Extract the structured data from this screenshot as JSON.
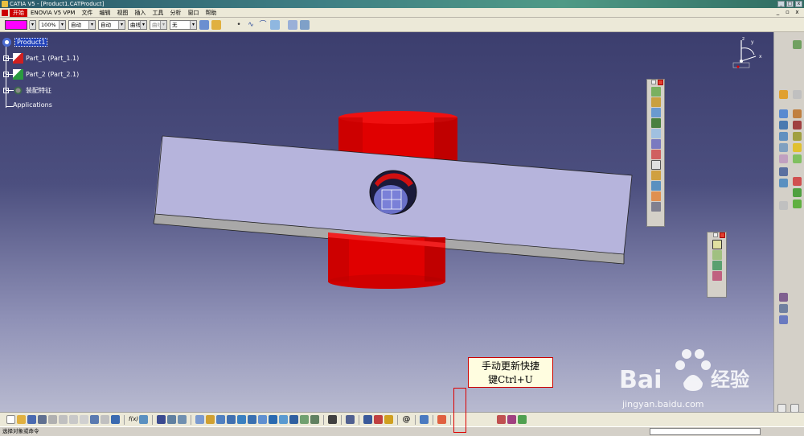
{
  "window": {
    "title": "CATIA V5 - [Product1.CATProduct]"
  },
  "menubar": {
    "items": [
      {
        "label": "开始",
        "active": true
      },
      {
        "label": "ENOVIA V5 VPM"
      },
      {
        "label": "文件"
      },
      {
        "label": "编辑"
      },
      {
        "label": "视图"
      },
      {
        "label": "插入"
      },
      {
        "label": "工具"
      },
      {
        "label": "分析"
      },
      {
        "label": "窗口"
      },
      {
        "label": "帮助"
      }
    ]
  },
  "properties": {
    "color_hex": "#ff00ff",
    "transparency": "100%",
    "line_thickness": "自动",
    "line_type": "自动",
    "point_type": "曲线",
    "layer_dropdown": "曲线",
    "layer": "无"
  },
  "tree": {
    "root": "Product1",
    "children": [
      {
        "label": "Part_1 (Part_1.1)"
      },
      {
        "label": "Part_2 (Part_2.1)"
      },
      {
        "label": "装配特征"
      }
    ],
    "applications": "Applications"
  },
  "compass": {
    "x_label": "x",
    "y_label": "y",
    "z_label": "z"
  },
  "annotation": {
    "line1": "手动更新快捷",
    "line2": "键Ctrl+U"
  },
  "watermark": {
    "brand": "Bai",
    "brand2": "经验",
    "url": "jingyan.baidu.com"
  },
  "statusbar": {
    "text": "选择对象或命令"
  },
  "colors": {
    "red_part": "#e00000",
    "plate": "#b4b2d8",
    "viewport_top": "#3c3e6e"
  }
}
